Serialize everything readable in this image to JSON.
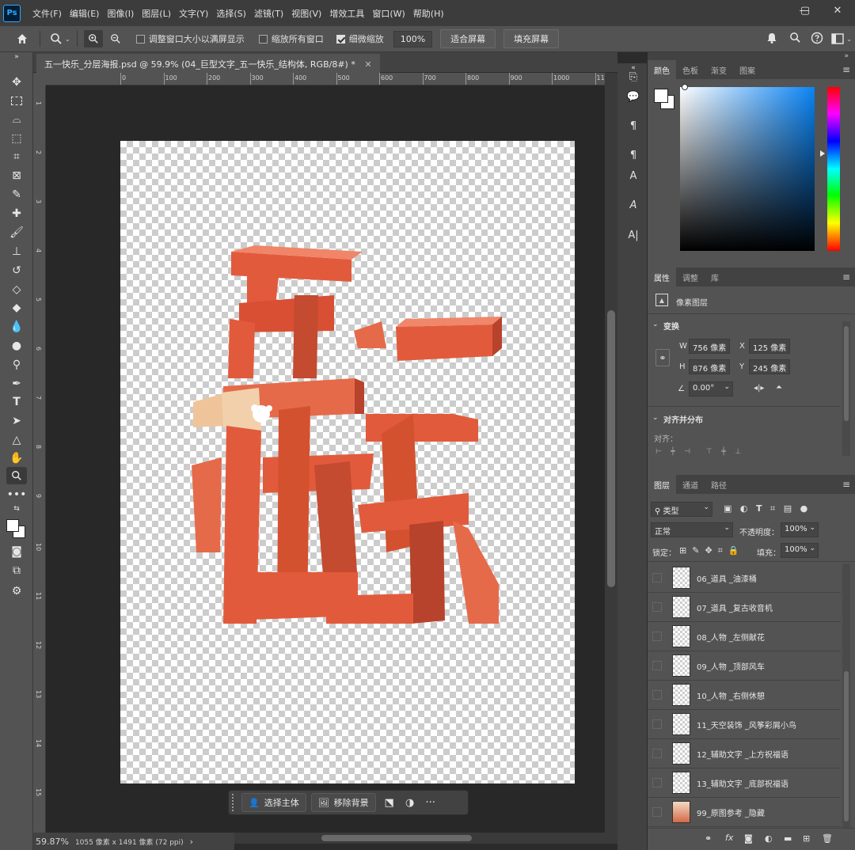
{
  "app": {
    "logo": "Ps"
  },
  "menu": [
    "文件(F)",
    "编辑(E)",
    "图像(I)",
    "图层(L)",
    "文字(Y)",
    "选择(S)",
    "滤镜(T)",
    "视图(V)",
    "增效工具",
    "窗口(W)",
    "帮助(H)"
  ],
  "options": {
    "resize_windows_label": "调整窗口大小以满屏显示",
    "zoom_all_label": "缩放所有窗口",
    "scrubby_label": "细微缩放",
    "zoom_value": "100%",
    "fit_screen_label": "适合屏幕",
    "fill_screen_label": "填充屏幕"
  },
  "document": {
    "tab_title": "五一快乐_分层海报.psd @ 59.9% (04_巨型文字_五一快乐_结构体, RGB/8#) *",
    "ruler_h_labels": [
      "0",
      "100",
      "200",
      "300",
      "400",
      "500",
      "600",
      "700",
      "800",
      "900",
      "1000",
      "110"
    ],
    "ruler_v_labels": [
      "1",
      "2",
      "3",
      "4",
      "5",
      "6",
      "7",
      "8",
      "9",
      "10",
      "11",
      "12",
      "13",
      "14",
      "15"
    ]
  },
  "status": {
    "zoom": "59.87%",
    "dimensions": "1055 像素 x 1491 像素 (72 ppi)"
  },
  "context_bar": {
    "select_subject": "选择主体",
    "remove_bg": "移除背景",
    "more": "···"
  },
  "color_panel": {
    "tabs": [
      "颜色",
      "色板",
      "渐变",
      "图案"
    ],
    "fg_color": "#ffffff",
    "picker_hue": "#0a84f5"
  },
  "properties_panel": {
    "tabs": [
      "属性",
      "调整",
      "库"
    ],
    "layer_type": "像素图层",
    "transform_title": "变换",
    "w_label": "W",
    "w_value": "756 像素",
    "x_label": "X",
    "x_value": "125 像素",
    "h_label": "H",
    "h_value": "876 像素",
    "y_label": "Y",
    "y_value": "245 像素",
    "angle_value": "0.00°",
    "align_title": "对齐并分布",
    "align_label": "对齐："
  },
  "layers_panel": {
    "tabs": [
      "图层",
      "通道",
      "路径"
    ],
    "filter_kind": "类型",
    "blend_mode": "正常",
    "opacity_label": "不透明度：",
    "opacity_value": "100%",
    "lock_label": "锁定：",
    "fill_label": "填充：",
    "fill_value": "100%",
    "layers": [
      {
        "name": "06_道具 _油漆桶"
      },
      {
        "name": "07_道具 _复古收音机"
      },
      {
        "name": "08_人物 _左侧献花"
      },
      {
        "name": "09_人物 _顶部风车"
      },
      {
        "name": "10_人物 _右侧休憩"
      },
      {
        "name": "11_天空装饰 _风筝彩屑小鸟"
      },
      {
        "name": "12_辅助文字 _上方祝福语"
      },
      {
        "name": "13_辅助文字 _底部祝福语"
      },
      {
        "name": "99_原图参考 _隐藏"
      }
    ]
  },
  "artwork": {
    "text": "五一快乐",
    "main_color": "#e25a3c",
    "shadow_color": "#b8432c",
    "light_color": "#f0c49a"
  }
}
